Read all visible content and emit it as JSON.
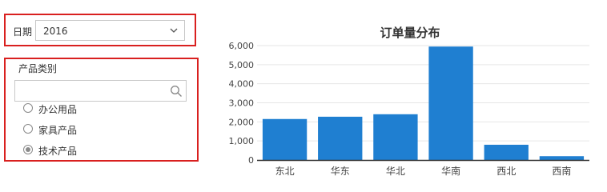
{
  "date_filter": {
    "label": "日期",
    "value": "2016"
  },
  "category_filter": {
    "title": "产品类别",
    "search_placeholder": "",
    "options": [
      {
        "label": "办公用品",
        "selected": false
      },
      {
        "label": "家具产品",
        "selected": false
      },
      {
        "label": "技术产品",
        "selected": true
      }
    ]
  },
  "chart_data": {
    "type": "bar",
    "title": "订单量分布",
    "categories": [
      "东北",
      "华东",
      "华北",
      "华南",
      "西北",
      "西南"
    ],
    "values": [
      2150,
      2270,
      2400,
      5950,
      800,
      200
    ],
    "ylim": [
      0,
      6000
    ],
    "yticks": [
      0,
      1000,
      2000,
      3000,
      4000,
      5000,
      6000
    ],
    "ytick_labels": [
      "0",
      "1,000",
      "2,000",
      "3,000",
      "4,000",
      "5,000",
      "6,000"
    ],
    "xlabel": "",
    "ylabel": "",
    "grid": true,
    "bar_color": "#1f7fd1"
  }
}
